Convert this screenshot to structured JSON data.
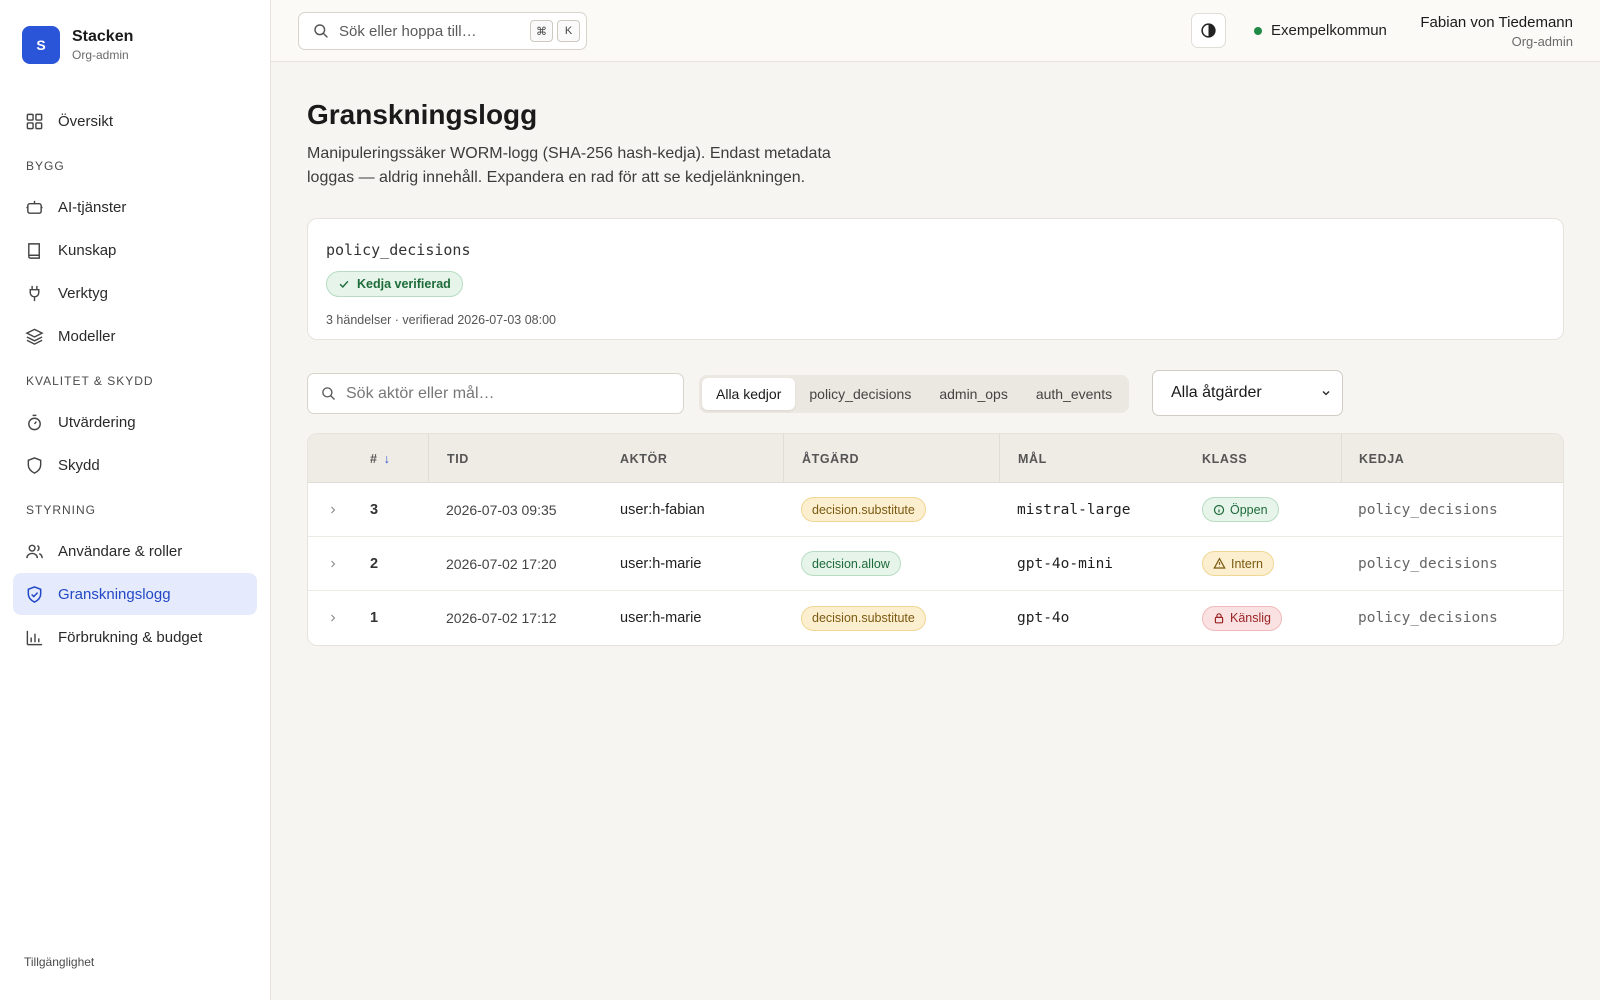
{
  "brand": {
    "logo_letter": "S",
    "name": "Stacken",
    "subtitle": "Org-admin"
  },
  "sidebar": {
    "overview": "Översikt",
    "sections": [
      {
        "title": "BYGG",
        "items": [
          "AI-tjänster",
          "Kunskap",
          "Verktyg",
          "Modeller"
        ]
      },
      {
        "title": "KVALITET & SKYDD",
        "items": [
          "Utvärdering",
          "Skydd"
        ]
      },
      {
        "title": "STYRNING",
        "items": [
          "Användare & roller",
          "Granskningslogg",
          "Förbrukning & budget"
        ]
      }
    ],
    "active_item": "Granskningslogg",
    "footer": "Tillgänglighet",
    "icons": [
      "grid-icon",
      "bot-icon",
      "book-icon",
      "plug-icon",
      "layers-icon",
      "timer-icon",
      "shield-icon",
      "users-icon",
      "shield-check-icon",
      "bar-chart-icon"
    ]
  },
  "topbar": {
    "search_placeholder": "Sök eller hoppa till…",
    "shortcut_keys": [
      "⌘",
      "K"
    ],
    "org_name": "Exempelkommun",
    "org_status_color": "#1f8a47",
    "user_name": "Fabian von Tiedemann",
    "user_role": "Org-admin"
  },
  "page": {
    "title": "Granskningslogg",
    "description": "Manipuleringssäker WORM-logg (SHA-256 hash-kedja). Endast metadata loggas — aldrig innehåll. Expandera en rad för att se kedjelänkningen."
  },
  "chain_card": {
    "name": "policy_decisions",
    "badge": "Kedja verifierad",
    "meta": "3 händelser · verifierad 2026-07-03 08:00"
  },
  "filters": {
    "search_placeholder": "Sök aktör eller mål…",
    "segments": [
      "Alla kedjor",
      "policy_decisions",
      "admin_ops",
      "auth_events"
    ],
    "active_segment": "Alla kedjor",
    "action_select": "Alla åtgärder"
  },
  "table": {
    "columns": [
      "#",
      "TID",
      "AKTÖR",
      "ÅTGÄRD",
      "MÅL",
      "KLASS",
      "KEDJA"
    ],
    "sort_indicator": "↓",
    "rows": [
      {
        "num": "3",
        "time": "2026-07-03 09:35",
        "actor": "user:h-fabian",
        "action": "decision.substitute",
        "action_kind": "warn",
        "target": "mistral-large",
        "class": "Öppen",
        "class_kind": "ok",
        "chain": "policy_decisions"
      },
      {
        "num": "2",
        "time": "2026-07-02 17:20",
        "actor": "user:h-marie",
        "action": "decision.allow",
        "action_kind": "ok",
        "target": "gpt-4o-mini",
        "class": "Intern",
        "class_kind": "warn",
        "chain": "policy_decisions"
      },
      {
        "num": "1",
        "time": "2026-07-02 17:12",
        "actor": "user:h-marie",
        "action": "decision.substitute",
        "action_kind": "warn",
        "target": "gpt-4o",
        "class": "Känslig",
        "class_kind": "err",
        "chain": "policy_decisions"
      }
    ]
  },
  "colors": {
    "accent": "#2b55d9",
    "active_bg": "#e5ebfd",
    "background": "#f6f5f1"
  }
}
